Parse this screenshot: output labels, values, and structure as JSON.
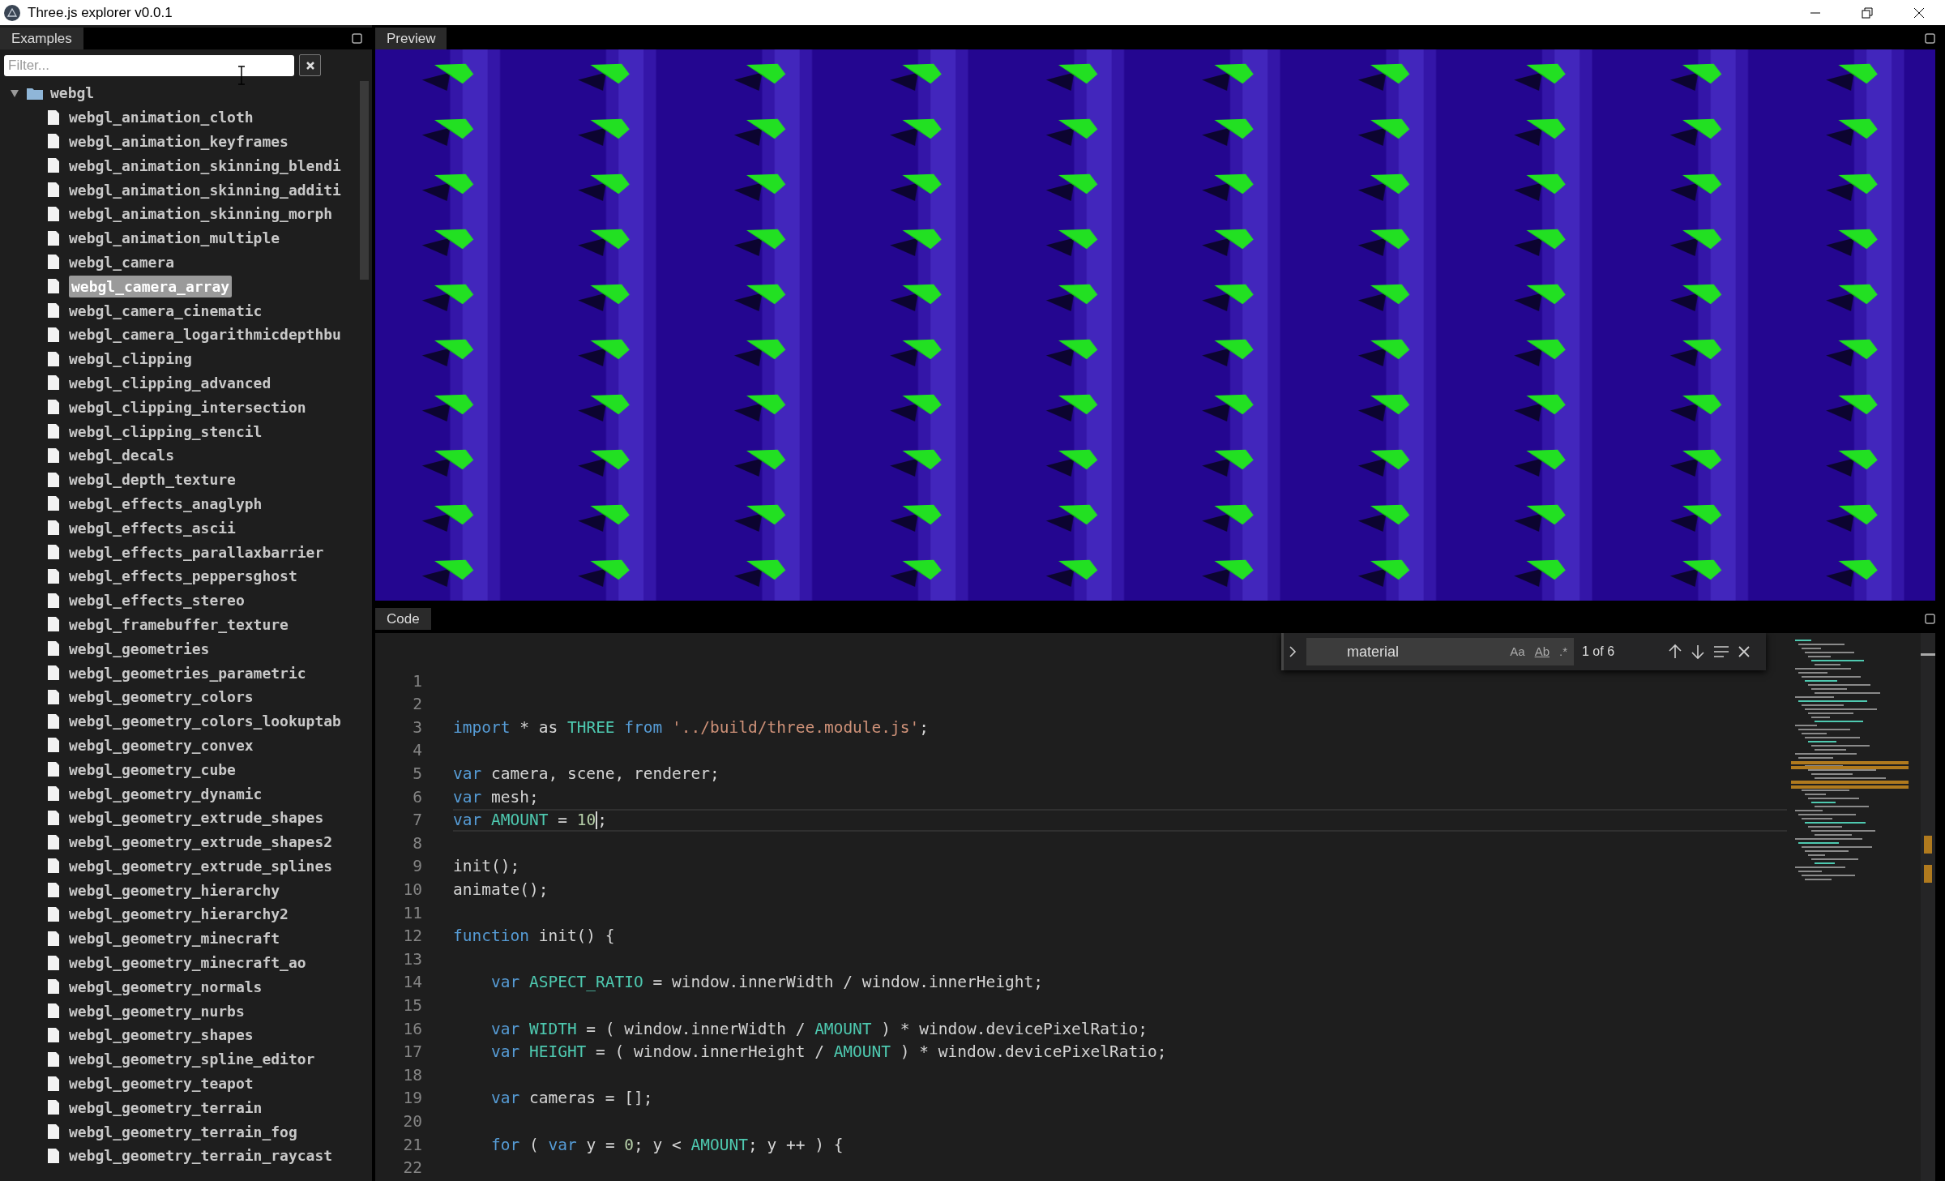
{
  "window": {
    "title": "Three.js explorer v0.0.1"
  },
  "sidebar": {
    "tab": {
      "label": "Examples",
      "selected": true
    },
    "filter": {
      "placeholder": "Filter..."
    },
    "tree": [
      {
        "label": "webgl",
        "kind": "folder",
        "expanded": true,
        "children": [
          {
            "label": "webgl_animation_cloth",
            "kind": "file",
            "selected": false
          },
          {
            "label": "webgl_animation_keyframes",
            "kind": "file",
            "selected": false
          },
          {
            "label": "webgl_animation_skinning_blendi",
            "kind": "file",
            "selected": false
          },
          {
            "label": "webgl_animation_skinning_additi",
            "kind": "file",
            "selected": false
          },
          {
            "label": "webgl_animation_skinning_morph",
            "kind": "file",
            "selected": false
          },
          {
            "label": "webgl_animation_multiple",
            "kind": "file",
            "selected": false
          },
          {
            "label": "webgl_camera",
            "kind": "file",
            "selected": false
          },
          {
            "label": "webgl_camera_array",
            "kind": "file",
            "selected": true
          },
          {
            "label": "webgl_camera_cinematic",
            "kind": "file",
            "selected": false
          },
          {
            "label": "webgl_camera_logarithmicdepthbu",
            "kind": "file",
            "selected": false
          },
          {
            "label": "webgl_clipping",
            "kind": "file",
            "selected": false
          },
          {
            "label": "webgl_clipping_advanced",
            "kind": "file",
            "selected": false
          },
          {
            "label": "webgl_clipping_intersection",
            "kind": "file",
            "selected": false
          },
          {
            "label": "webgl_clipping_stencil",
            "kind": "file",
            "selected": false
          },
          {
            "label": "webgl_decals",
            "kind": "file",
            "selected": false
          },
          {
            "label": "webgl_depth_texture",
            "kind": "file",
            "selected": false
          },
          {
            "label": "webgl_effects_anaglyph",
            "kind": "file",
            "selected": false
          },
          {
            "label": "webgl_effects_ascii",
            "kind": "file",
            "selected": false
          },
          {
            "label": "webgl_effects_parallaxbarrier",
            "kind": "file",
            "selected": false
          },
          {
            "label": "webgl_effects_peppersghost",
            "kind": "file",
            "selected": false
          },
          {
            "label": "webgl_effects_stereo",
            "kind": "file",
            "selected": false
          },
          {
            "label": "webgl_framebuffer_texture",
            "kind": "file",
            "selected": false
          },
          {
            "label": "webgl_geometries",
            "kind": "file",
            "selected": false
          },
          {
            "label": "webgl_geometries_parametric",
            "kind": "file",
            "selected": false
          },
          {
            "label": "webgl_geometry_colors",
            "kind": "file",
            "selected": false
          },
          {
            "label": "webgl_geometry_colors_lookuptab",
            "kind": "file",
            "selected": false
          },
          {
            "label": "webgl_geometry_convex",
            "kind": "file",
            "selected": false
          },
          {
            "label": "webgl_geometry_cube",
            "kind": "file",
            "selected": false
          },
          {
            "label": "webgl_geometry_dynamic",
            "kind": "file",
            "selected": false
          },
          {
            "label": "webgl_geometry_extrude_shapes",
            "kind": "file",
            "selected": false
          },
          {
            "label": "webgl_geometry_extrude_shapes2",
            "kind": "file",
            "selected": false
          },
          {
            "label": "webgl_geometry_extrude_splines",
            "kind": "file",
            "selected": false
          },
          {
            "label": "webgl_geometry_hierarchy",
            "kind": "file",
            "selected": false
          },
          {
            "label": "webgl_geometry_hierarchy2",
            "kind": "file",
            "selected": false
          },
          {
            "label": "webgl_geometry_minecraft",
            "kind": "file",
            "selected": false
          },
          {
            "label": "webgl_geometry_minecraft_ao",
            "kind": "file",
            "selected": false
          },
          {
            "label": "webgl_geometry_normals",
            "kind": "file",
            "selected": false
          },
          {
            "label": "webgl_geometry_nurbs",
            "kind": "file",
            "selected": false
          },
          {
            "label": "webgl_geometry_shapes",
            "kind": "file",
            "selected": false
          },
          {
            "label": "webgl_geometry_spline_editor",
            "kind": "file",
            "selected": false
          },
          {
            "label": "webgl_geometry_teapot",
            "kind": "file",
            "selected": false
          },
          {
            "label": "webgl_geometry_terrain",
            "kind": "file",
            "selected": false
          },
          {
            "label": "webgl_geometry_terrain_fog",
            "kind": "file",
            "selected": false
          },
          {
            "label": "webgl_geometry_terrain_raycast",
            "kind": "file",
            "selected": false
          }
        ]
      }
    ]
  },
  "preview": {
    "tab": {
      "label": "Preview",
      "selected": true
    }
  },
  "code": {
    "tab": {
      "label": "Code",
      "selected": true
    },
    "find": {
      "value": "material",
      "options": [
        {
          "label": "Aa",
          "selected": false
        },
        {
          "label": "Ab",
          "selected": false
        },
        {
          "label": ".*",
          "selected": false
        }
      ],
      "count": "1 of 6"
    },
    "lines": [
      {
        "number": "1",
        "current": false
      },
      {
        "number": "2",
        "current": false
      },
      {
        "number": "3",
        "current": false,
        "tokens": [
          {
            "text": "import",
            "kind": "keyword"
          },
          {
            "text": " * as ",
            "kind": "plain"
          },
          {
            "text": "THREE",
            "kind": "constant"
          },
          {
            "text": " from ",
            "kind": "keyword"
          },
          {
            "text": "'../build/three.module.js'",
            "kind": "string"
          },
          {
            "text": ";",
            "kind": "plain"
          }
        ]
      },
      {
        "number": "4",
        "current": false
      },
      {
        "number": "5",
        "current": false,
        "tokens": [
          {
            "text": "var",
            "kind": "keyword"
          },
          {
            "text": " camera, scene, renderer;",
            "kind": "plain"
          }
        ]
      },
      {
        "number": "6",
        "current": false,
        "tokens": [
          {
            "text": "var",
            "kind": "keyword"
          },
          {
            "text": " mesh;",
            "kind": "plain"
          }
        ]
      },
      {
        "number": "7",
        "current": true,
        "tokens": [
          {
            "text": "var ",
            "kind": "keyword"
          },
          {
            "text": "AMOUNT",
            "kind": "constant"
          },
          {
            "text": " = ",
            "kind": "plain"
          },
          {
            "text": "10",
            "kind": "number"
          },
          {
            "kind": "cursor"
          },
          {
            "text": ";",
            "kind": "plain"
          }
        ]
      },
      {
        "number": "8",
        "current": false
      },
      {
        "number": "9",
        "current": false,
        "tokens": [
          {
            "text": "init();",
            "kind": "plain"
          }
        ]
      },
      {
        "number": "10",
        "current": false,
        "tokens": [
          {
            "text": "animate();",
            "kind": "plain"
          }
        ]
      },
      {
        "number": "11",
        "current": false
      },
      {
        "number": "12",
        "current": false,
        "tokens": [
          {
            "text": "function",
            "kind": "keyword"
          },
          {
            "text": " init() {",
            "kind": "plain"
          }
        ]
      },
      {
        "number": "13",
        "current": false
      },
      {
        "number": "14",
        "current": false,
        "tokens": [
          {
            "text": "    var ",
            "kind": "keyword"
          },
          {
            "text": "ASPECT_RATIO",
            "kind": "constant"
          },
          {
            "text": " = window.innerWidth / window.innerHeight;",
            "kind": "plain"
          }
        ]
      },
      {
        "number": "15",
        "current": false
      },
      {
        "number": "16",
        "current": false,
        "tokens": [
          {
            "text": "    var ",
            "kind": "keyword"
          },
          {
            "text": "WIDTH",
            "kind": "constant"
          },
          {
            "text": " = ( window.innerWidth / ",
            "kind": "plain"
          },
          {
            "text": "AMOUNT",
            "kind": "constant"
          },
          {
            "text": " ) * window.devicePixelRatio;",
            "kind": "plain"
          }
        ]
      },
      {
        "number": "17",
        "current": false,
        "tokens": [
          {
            "text": "    var ",
            "kind": "keyword"
          },
          {
            "text": "HEIGHT",
            "kind": "constant"
          },
          {
            "text": " = ( window.innerHeight / ",
            "kind": "plain"
          },
          {
            "text": "AMOUNT",
            "kind": "constant"
          },
          {
            "text": " ) * window.devicePixelRatio;",
            "kind": "plain"
          }
        ]
      },
      {
        "number": "18",
        "current": false
      },
      {
        "number": "19",
        "current": false,
        "tokens": [
          {
            "text": "    var",
            "kind": "keyword"
          },
          {
            "text": " cameras = [];",
            "kind": "plain"
          }
        ]
      },
      {
        "number": "20",
        "current": false
      },
      {
        "number": "21",
        "current": false,
        "tokens": [
          {
            "text": "    for",
            "kind": "keyword"
          },
          {
            "text": " ( ",
            "kind": "plain"
          },
          {
            "text": "var",
            "kind": "keyword"
          },
          {
            "text": " y = ",
            "kind": "plain"
          },
          {
            "text": "0",
            "kind": "number"
          },
          {
            "text": "; y < ",
            "kind": "plain"
          },
          {
            "text": "AMOUNT",
            "kind": "constant"
          },
          {
            "text": "; y ++ ) {",
            "kind": "plain"
          }
        ]
      },
      {
        "number": "22",
        "current": false
      }
    ]
  }
}
